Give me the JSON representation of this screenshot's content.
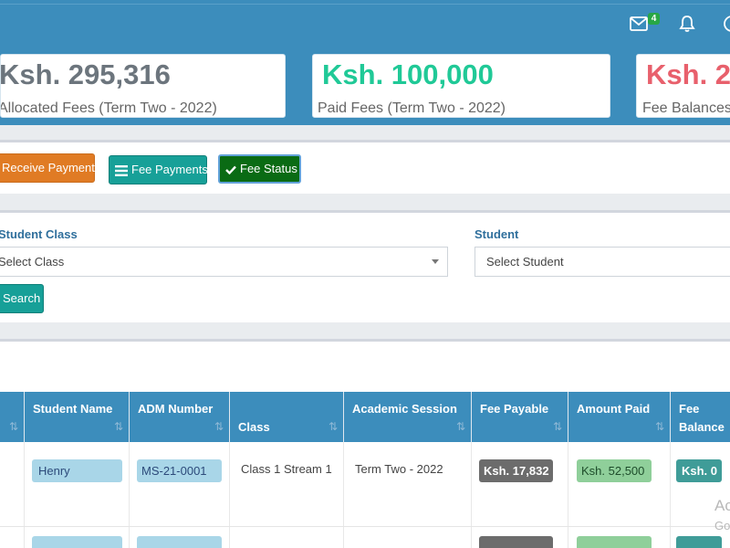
{
  "header": {
    "mail_badge": "4",
    "icons": [
      "mail-icon",
      "bell-icon",
      "user-icon"
    ]
  },
  "stats": {
    "allocated": {
      "value": "Ksh. 295,316",
      "label": "Allocated Fees (Term Two - 2022)"
    },
    "paid": {
      "value": "Ksh. 100,000",
      "label": "Paid Fees (Term Two - 2022)"
    },
    "balances": {
      "value": "Ksh. 2",
      "label": "Fee Balances"
    }
  },
  "actions": {
    "receive": "Receive Payment",
    "payments": "Fee Payments",
    "status": "Fee Status"
  },
  "filters": {
    "class_label": "Student Class",
    "class_value": "Select Class",
    "student_label": "Student",
    "student_value": "Select Student",
    "search": "Search"
  },
  "table": {
    "headers": [
      "Student Name",
      "ADM Number",
      "Class",
      "Academic Session",
      "Fee Payable",
      "Amount Paid",
      "Fee Balance"
    ],
    "rows": [
      {
        "name": "Henry",
        "adm": "MS-21-0001",
        "class": "Class 1 Stream 1",
        "session": "Term Two - 2022",
        "payable": "Ksh. 17,832",
        "paid": "Ksh. 52,500",
        "balance": "Ksh. 0"
      }
    ]
  },
  "watermark": {
    "line1": "Ac",
    "line2": "Go"
  },
  "colors": {
    "primary": "#3c8dbc",
    "receive": "#e07b24",
    "teal": "#17a098",
    "status": "#0a6b14",
    "paid_value": "#20c997",
    "balance_value": "#e8606c"
  }
}
